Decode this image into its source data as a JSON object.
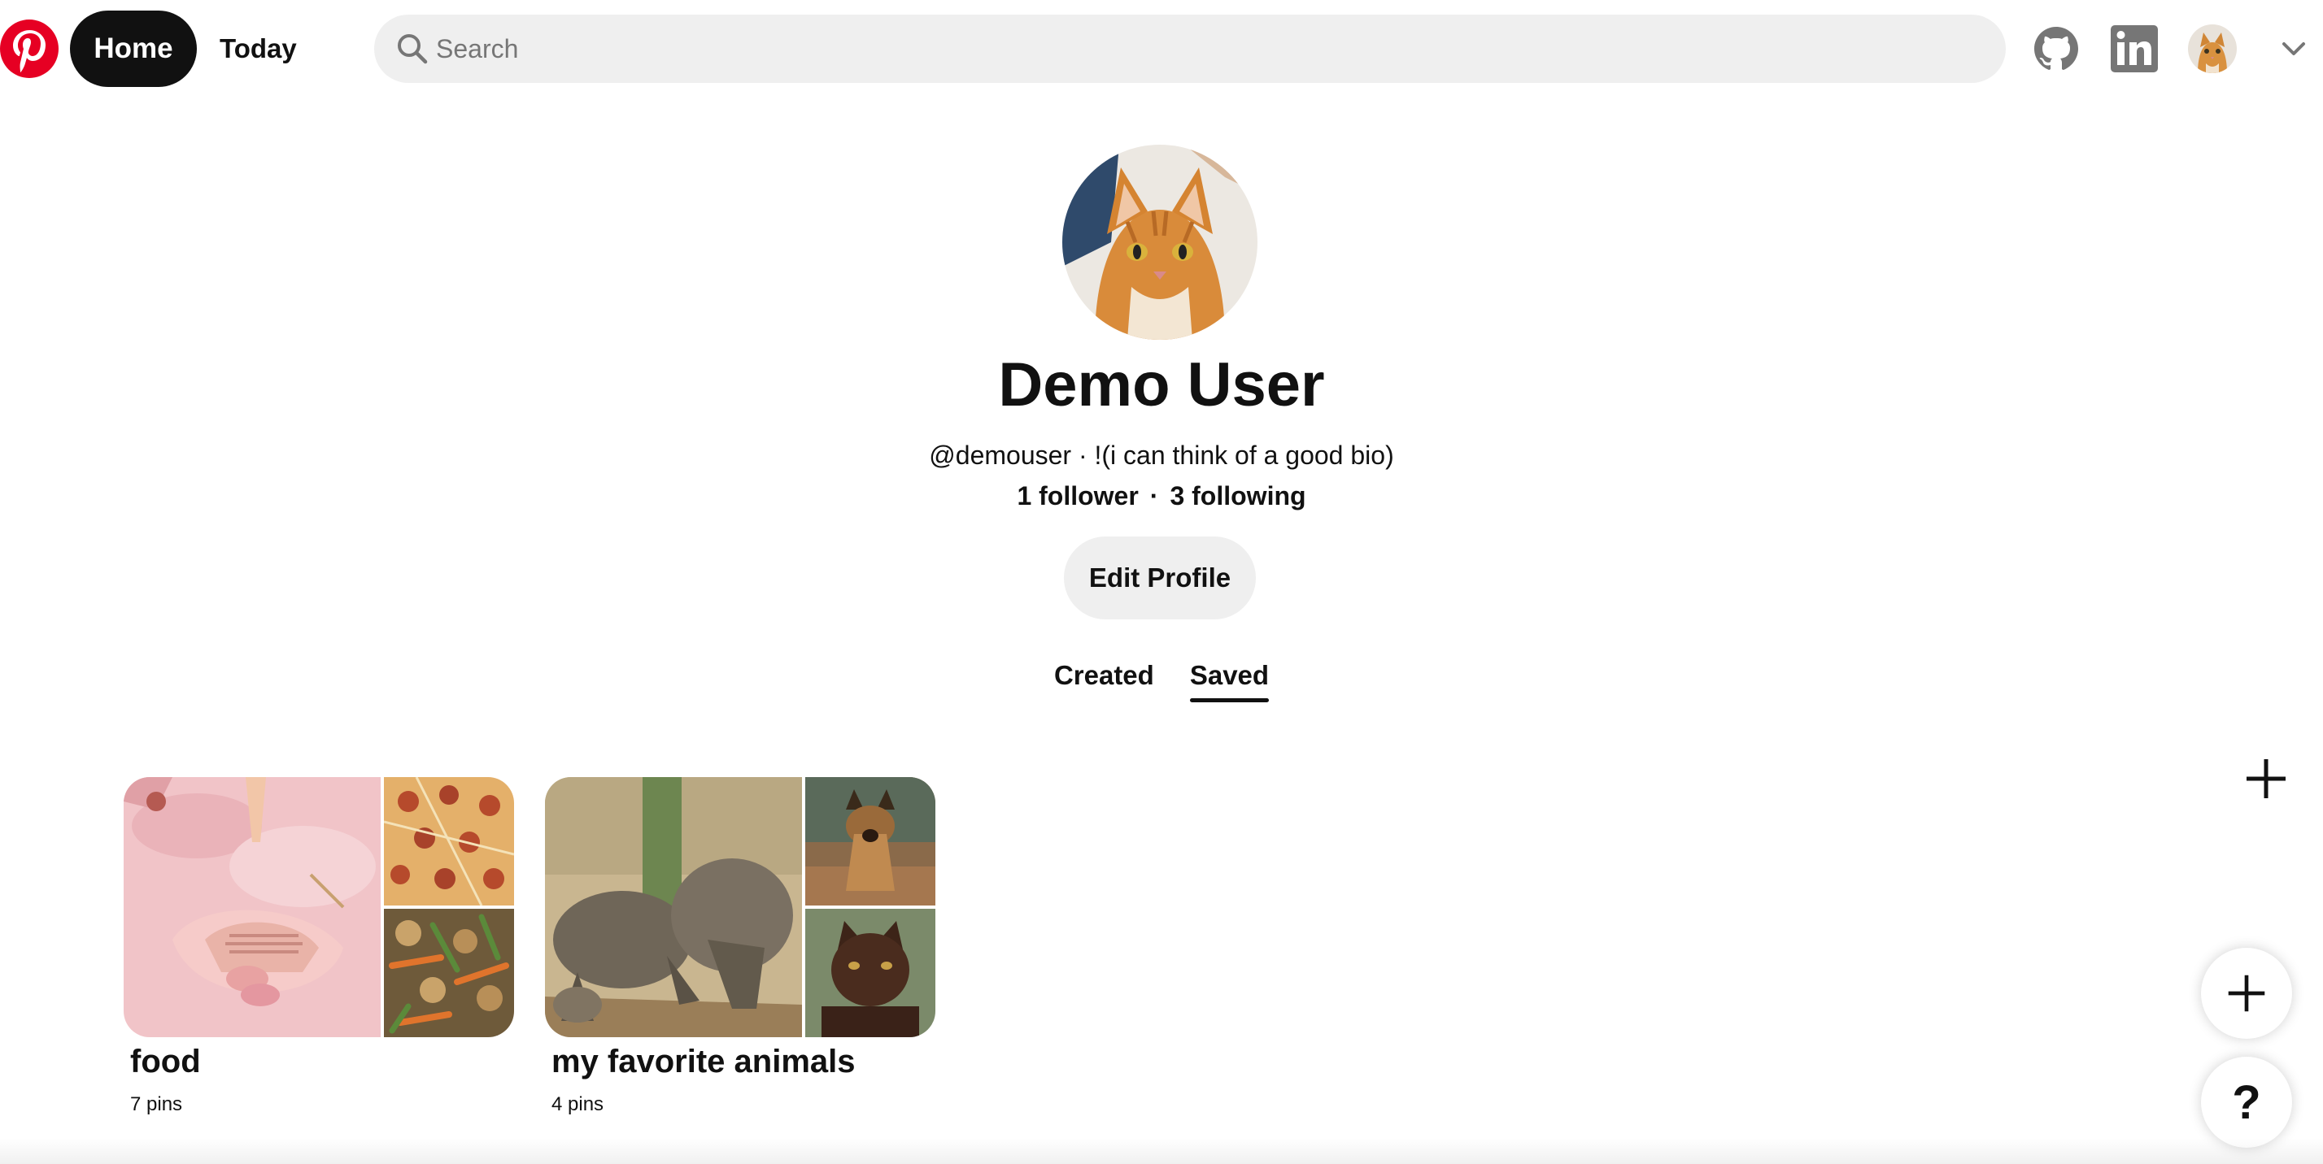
{
  "header": {
    "logo_icon": "pinterest-logo-icon",
    "brand_color": "#e60023",
    "nav": {
      "home_label": "Home",
      "today_label": "Today"
    },
    "search": {
      "placeholder": "Search",
      "value": ""
    },
    "icons": [
      "github-icon",
      "linkedin-icon",
      "chevron-down-icon"
    ]
  },
  "profile": {
    "name": "Demo User",
    "handle_bio": "@demouser · !(i can think of a good bio)",
    "followers": "1 follower",
    "separator": "·",
    "following": "3 following",
    "edit_label": "Edit Profile"
  },
  "tabs": [
    {
      "label": "Created",
      "active": false
    },
    {
      "label": "Saved",
      "active": true
    }
  ],
  "boards": [
    {
      "title": "food",
      "count": "7 pins"
    },
    {
      "title": "my favorite animals",
      "count": "4 pins"
    }
  ],
  "fabs": {
    "help_label": "?"
  }
}
